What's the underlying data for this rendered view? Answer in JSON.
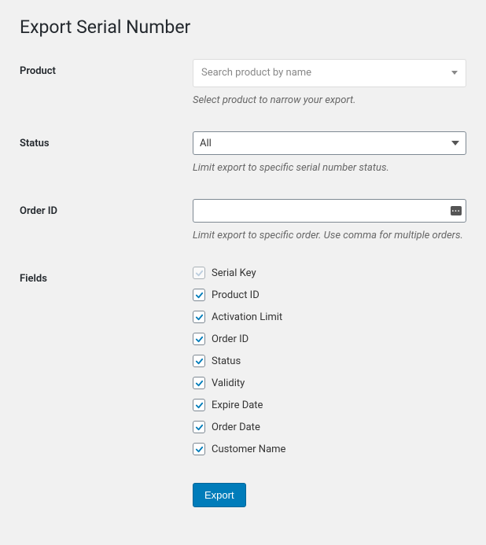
{
  "page_title": "Export Serial Number",
  "product": {
    "label": "Product",
    "placeholder": "Search product by name",
    "description": "Select product to narrow your export."
  },
  "status": {
    "label": "Status",
    "selected": "All",
    "description": "Limit export to specific serial number status."
  },
  "order_id": {
    "label": "Order ID",
    "value": "",
    "description": "Limit export to specific order. Use comma for multiple orders."
  },
  "fields": {
    "label": "Fields",
    "items": [
      {
        "label": "Serial Key",
        "checked": true,
        "disabled": true
      },
      {
        "label": "Product ID",
        "checked": true,
        "disabled": false
      },
      {
        "label": "Activation Limit",
        "checked": true,
        "disabled": false
      },
      {
        "label": "Order ID",
        "checked": true,
        "disabled": false
      },
      {
        "label": "Status",
        "checked": true,
        "disabled": false
      },
      {
        "label": "Validity",
        "checked": true,
        "disabled": false
      },
      {
        "label": "Expire Date",
        "checked": true,
        "disabled": false
      },
      {
        "label": "Order Date",
        "checked": true,
        "disabled": false
      },
      {
        "label": "Customer Name",
        "checked": true,
        "disabled": false
      }
    ]
  },
  "submit": {
    "label": "Export"
  }
}
